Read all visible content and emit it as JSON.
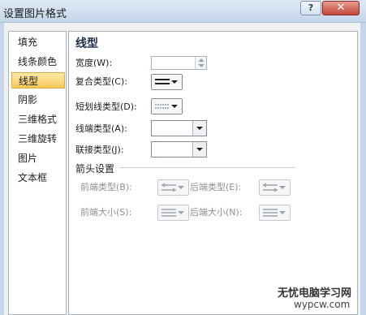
{
  "window": {
    "title": "设置图片格式",
    "help_label": "?",
    "close_label": "✕"
  },
  "nav": {
    "items": [
      {
        "label": "填充"
      },
      {
        "label": "线条颜色"
      },
      {
        "label": "线型"
      },
      {
        "label": "阴影"
      },
      {
        "label": "三维格式"
      },
      {
        "label": "三维旋转"
      },
      {
        "label": "图片"
      },
      {
        "label": "文本框"
      }
    ],
    "selected": "线型"
  },
  "panel": {
    "title": "线型",
    "width_label": "宽度(W):",
    "width_value": "",
    "compound_label": "复合类型(C):",
    "dash_label": "短划线类型(D):",
    "cap_label": "线端类型(A):",
    "cap_value": "",
    "join_label": "联接类型(J):",
    "join_value": "",
    "arrow_section_title": "箭头设置",
    "begin_type_label": "前端类型(B):",
    "end_type_label": "后端类型(E):",
    "begin_size_label": "前端大小(S):",
    "end_size_label": "后端大小(N):"
  },
  "icons": {
    "compound": "compound-line-icon",
    "dash": "dash-line-icon",
    "arrow_type": "arrow-type-icon",
    "arrow_size": "arrow-size-icon"
  },
  "colors": {
    "title_bar": "#c5d6ea",
    "selected_nav": "#f7c85a",
    "close_button": "#c2463a"
  },
  "watermark": {
    "line1": "无忧电脑学习网",
    "line2": "wypcw.com"
  }
}
